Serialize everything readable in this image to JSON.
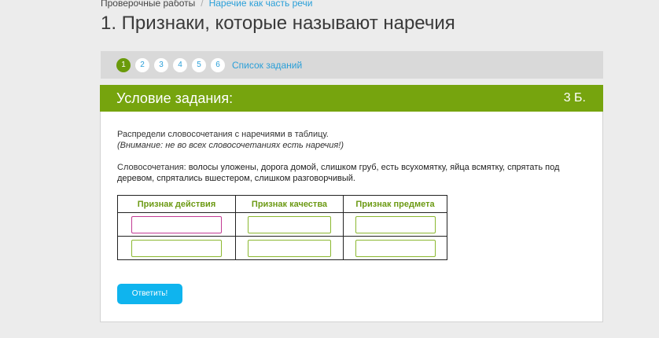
{
  "breadcrumb": {
    "home": "Проверочные работы",
    "separator": "/",
    "current": "Наречие как часть речи"
  },
  "page_title": "1. Признаки, которые называют наречия",
  "task_nav": {
    "items": [
      "1",
      "2",
      "3",
      "4",
      "5",
      "6"
    ],
    "active_index": 0,
    "list_link": "Список заданий"
  },
  "card": {
    "title": "Условие задания:",
    "score": "3 Б."
  },
  "instruction": {
    "text": "Распредели словосочетания с наречиями в таблицу.",
    "note": "(Внимание: не во всех словосочетаниях есть наречия!)"
  },
  "phrases": {
    "label": "Словосочетания: ",
    "text": "волосы уложены, дорога домой, слишком груб, есть всухомятку, яйца всмятку, спрятать под деревом, спрятались вшестером, слишком разговорчивый."
  },
  "table": {
    "headers": [
      "Признак действия",
      "Признак качества",
      "Признак предмета"
    ],
    "rows": [
      [
        "",
        "",
        ""
      ],
      [
        "",
        "",
        ""
      ]
    ]
  },
  "submit_label": "Ответить!",
  "colors": {
    "accent_green": "#76a40e",
    "link_blue": "#2a9fd8",
    "button_blue": "#0fb4ee",
    "input_border_green": "#8bb830",
    "input_border_focus": "#c23a93"
  }
}
